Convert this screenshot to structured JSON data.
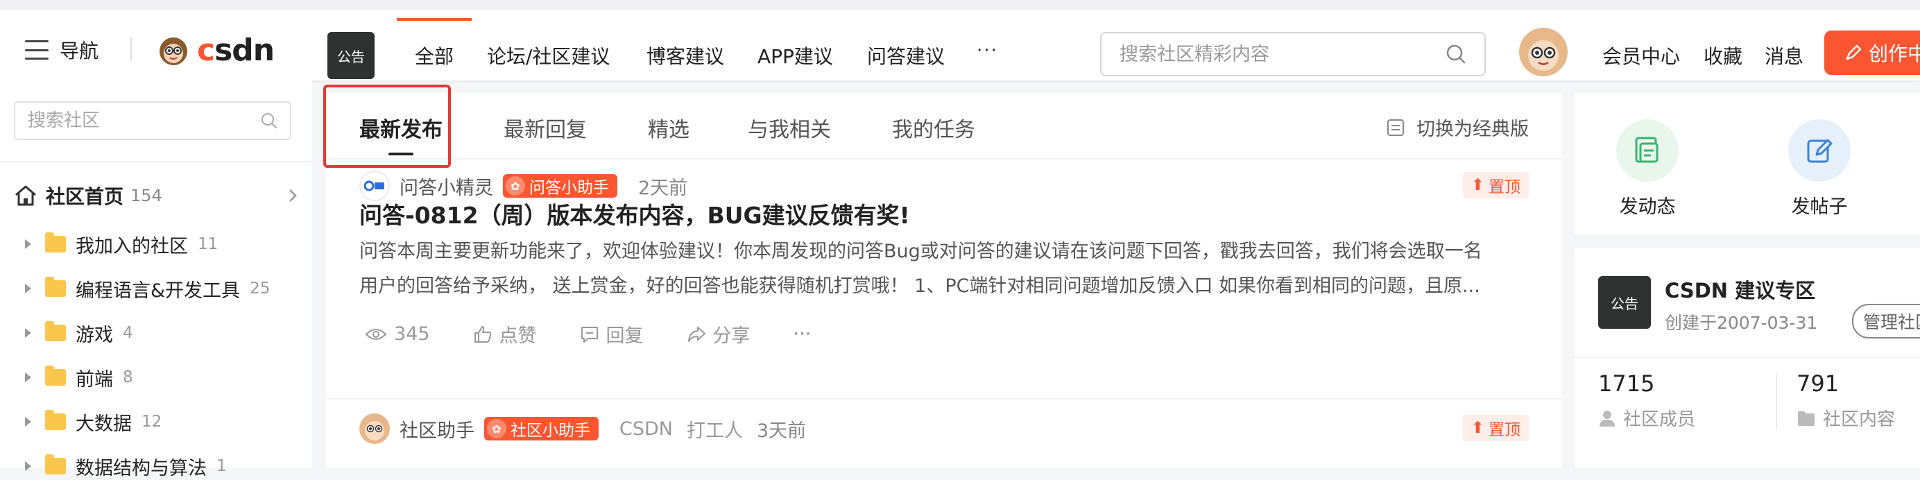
{
  "header": {
    "nav_label": "导航",
    "logo_text": "CSDN",
    "notice_badge": "公告",
    "tabs": [
      {
        "label": "全部",
        "active": true
      },
      {
        "label": "论坛/社区建议"
      },
      {
        "label": "博客建议"
      },
      {
        "label": "APP建议"
      },
      {
        "label": "问答建议"
      }
    ],
    "more_label": "···",
    "search_placeholder": "搜索社区精彩内容",
    "links": [
      "会员中心",
      "收藏",
      "消息"
    ],
    "create_label": "创作中"
  },
  "sidebar": {
    "search_placeholder": "搜索社区",
    "home": {
      "label": "社区首页",
      "count": "154"
    },
    "items": [
      {
        "label": "我加入的社区",
        "count": "11"
      },
      {
        "label": "编程语言&开发工具",
        "count": "25"
      },
      {
        "label": "游戏",
        "count": "4"
      },
      {
        "label": "前端",
        "count": "8"
      },
      {
        "label": "大数据",
        "count": "12"
      },
      {
        "label": "数据结构与算法",
        "count": "1"
      }
    ]
  },
  "main": {
    "sub_tabs": [
      {
        "label": "最新发布",
        "active": true
      },
      {
        "label": "最新回复"
      },
      {
        "label": "精选"
      },
      {
        "label": "与我相关"
      },
      {
        "label": "我的任务"
      }
    ],
    "switch_label": "切换为经典版",
    "posts": [
      {
        "author": "问答小精灵",
        "badge": "问答小助手",
        "time": "2天前",
        "pin": "置顶",
        "title": "问答-0812（周）版本发布内容，BUG建议反馈有奖!",
        "body_line1": "问答本周主要更新功能来了，欢迎体验建议！你本周发现的问答Bug或对问答的建议请在该问题下回答，戳我去回答，我们将会选取一名",
        "body_line2": "用户的回答给予采纳，  送上赏金，好的回答也能获得随机打赏哦！  1、PC端针对相同问题增加反馈入口  如果你看到相同的问题，且原...",
        "views": "345",
        "like_label": "点赞",
        "reply_label": "回复",
        "share_label": "分享",
        "more": "···"
      },
      {
        "author": "社区助手",
        "badge": "社区小助手",
        "source": "CSDN",
        "role": "打工人",
        "time": "3天前",
        "pin": "置顶"
      }
    ]
  },
  "right": {
    "actions": [
      {
        "label": "发动态"
      },
      {
        "label": "发帖子"
      }
    ],
    "community": {
      "logo": "公告",
      "name": "CSDN 建议专区",
      "created": "创建于2007-03-31",
      "manage_label": "管理社区"
    },
    "stats": [
      {
        "value": "1715",
        "label": "社区成员"
      },
      {
        "value": "791",
        "label": "社区内容"
      }
    ]
  },
  "colors": {
    "brand": "#fc5531",
    "notice_bg": "#2e3230",
    "folder": "#fbc64c",
    "highlight_box": "#e53935"
  }
}
